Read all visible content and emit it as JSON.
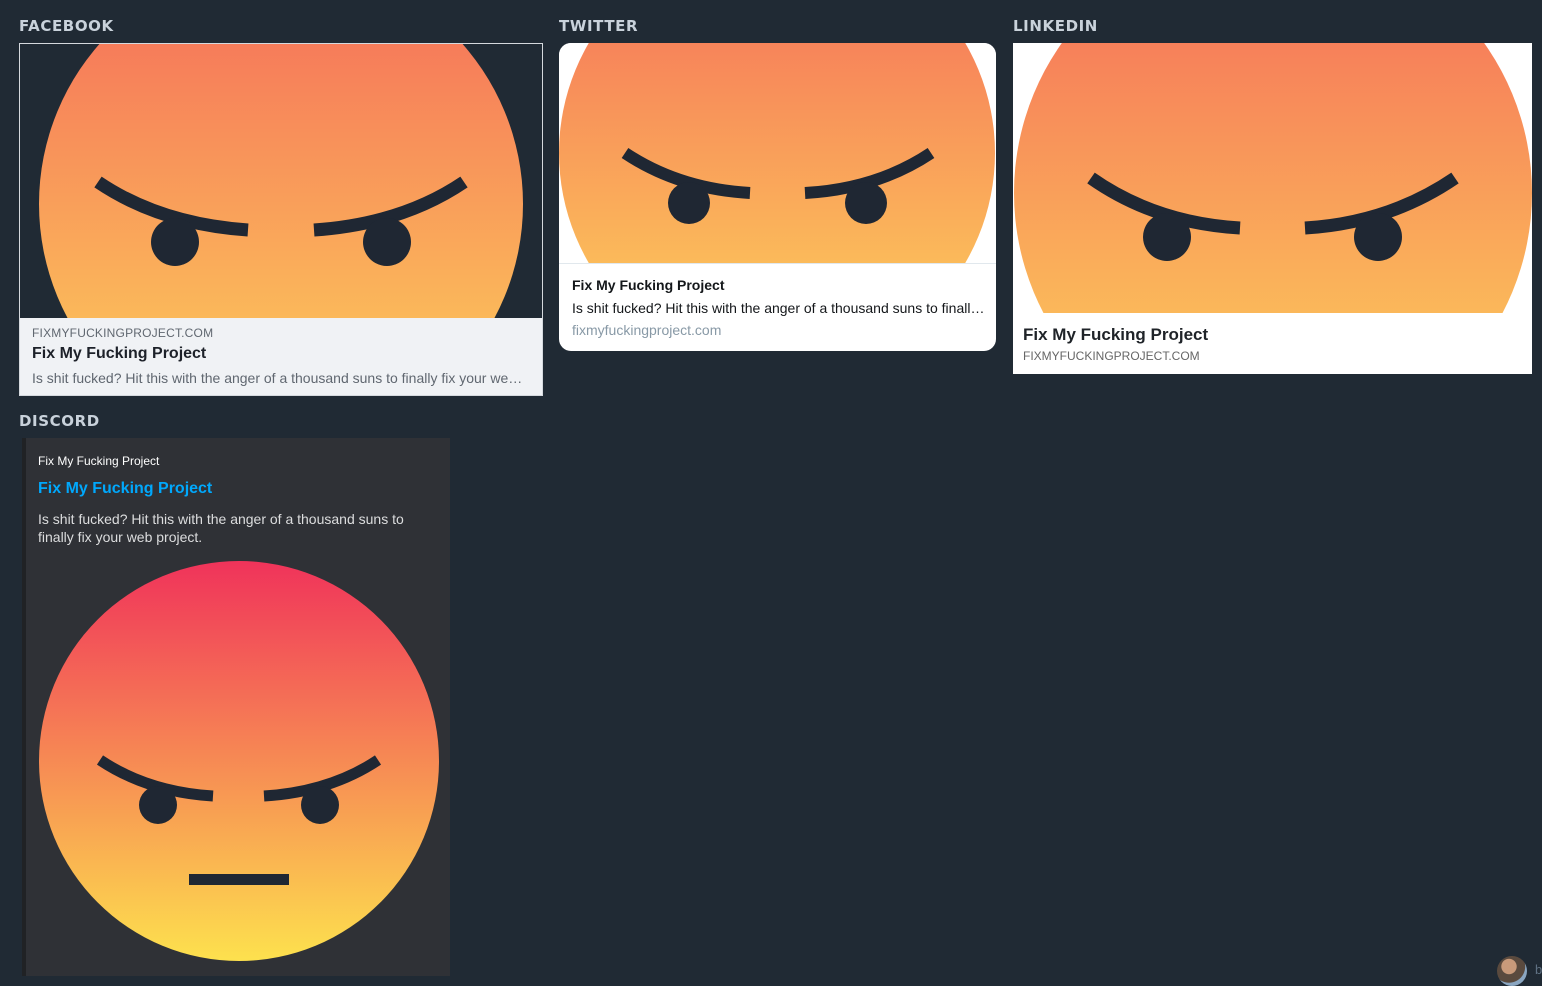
{
  "labels": {
    "facebook": "FACEBOOK",
    "twitter": "TWITTER",
    "linkedin": "LINKEDIN",
    "discord": "DISCORD"
  },
  "facebook": {
    "domain": "FIXMYFUCKINGPROJECT.COM",
    "title": "Fix My Fucking Project",
    "description": "Is shit fucked? Hit this with the anger of a thousand suns to finally fix your web project."
  },
  "twitter": {
    "title": "Fix My Fucking Project",
    "description": "Is shit fucked? Hit this with the anger of a thousand suns to finally fix your web project.",
    "domain": "fixmyfuckingproject.com"
  },
  "linkedin": {
    "title": "Fix My Fucking Project",
    "domain": "FIXMYFUCKINGPROJECT.COM"
  },
  "discord": {
    "provider": "Fix My Fucking Project",
    "title": "Fix My Fucking Project",
    "description": "Is shit fucked? Hit this with the anger of a thousand suns to finally fix your web project."
  },
  "corner": {
    "text": "b"
  },
  "icons": {
    "preview_image": "angry-face-icon",
    "avatar": "user-avatar"
  },
  "colors": {
    "page_bg": "#202a34",
    "face_top": "#f56a5a",
    "face_bottom": "#fdd45a",
    "discord_face_top": "#f0335a",
    "discord_face_bottom": "#fde14e",
    "discord_link": "#00a8fc"
  }
}
